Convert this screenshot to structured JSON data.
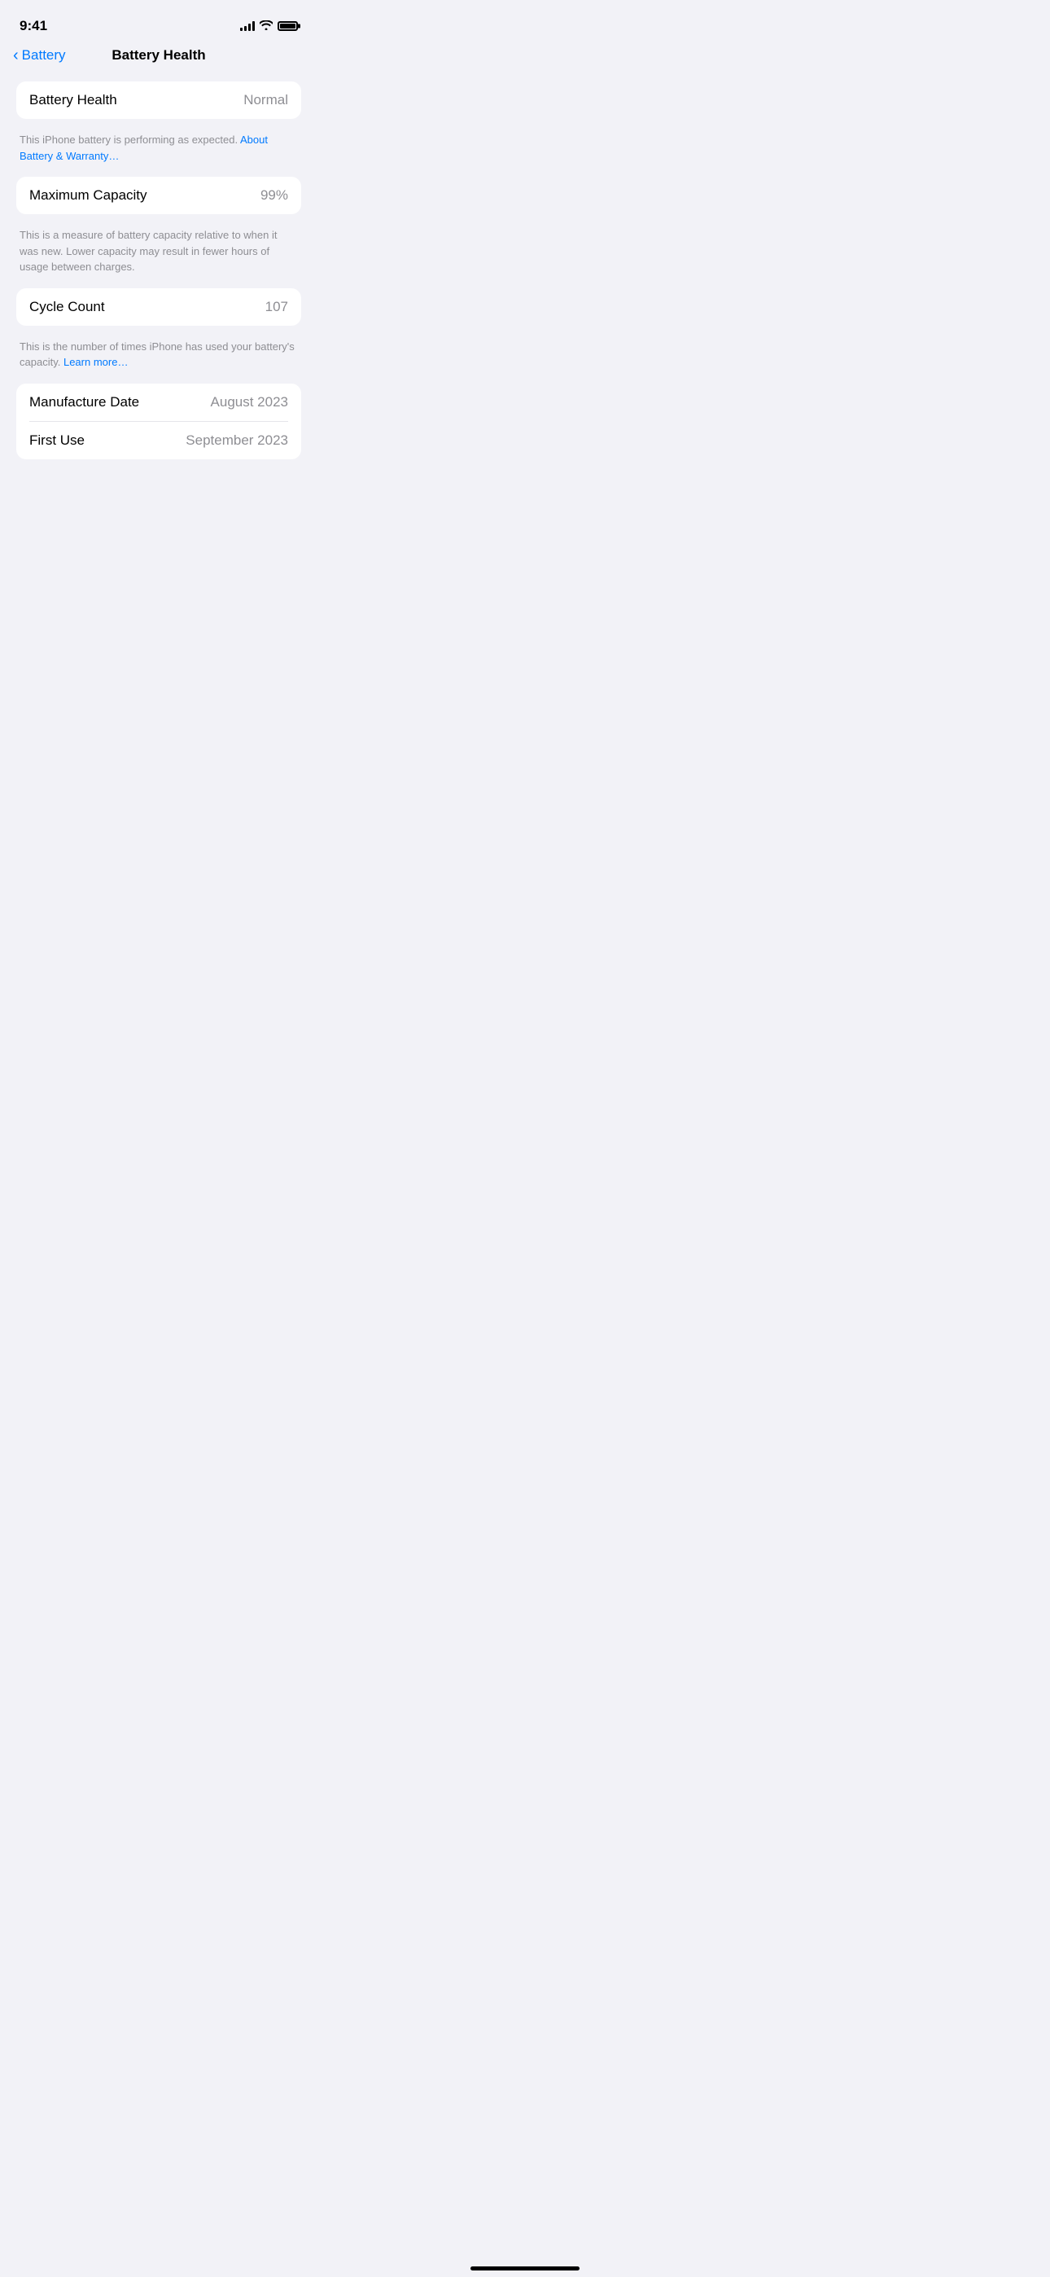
{
  "statusBar": {
    "time": "9:41",
    "batteryLevel": 90
  },
  "navBar": {
    "backLabel": "Battery",
    "title": "Battery Health"
  },
  "sections": {
    "batteryHealth": {
      "label": "Battery Health",
      "value": "Normal",
      "description": "This iPhone battery is performing as expected.",
      "linkText": "About Battery & Warranty…"
    },
    "maximumCapacity": {
      "label": "Maximum Capacity",
      "value": "99%",
      "description": "This is a measure of battery capacity relative to when it was new. Lower capacity may result in fewer hours of usage between charges."
    },
    "cycleCount": {
      "label": "Cycle Count",
      "value": "107",
      "description": "This is the number of times iPhone has used your battery's capacity.",
      "linkText": "Learn more…"
    },
    "dates": {
      "manufactureLabel": "Manufacture Date",
      "manufactureValue": "August 2023",
      "firstUseLabel": "First Use",
      "firstUseValue": "September 2023"
    }
  }
}
